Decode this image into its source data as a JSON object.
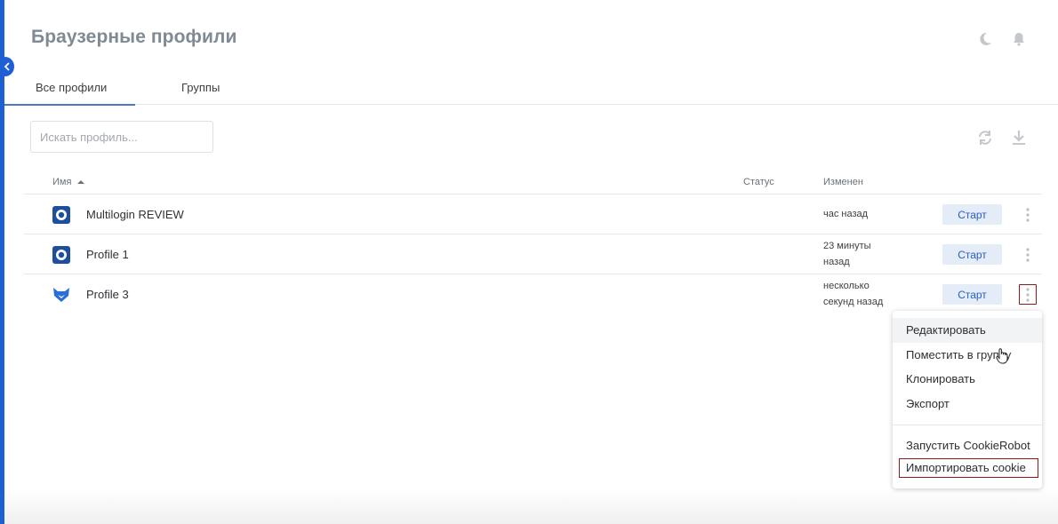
{
  "page_title": "Браузерные профили",
  "colors": {
    "accent": "#1f5fd6",
    "start_bg": "#e4ecf7",
    "highlight": "#8b1a1a"
  },
  "header_icons": [
    "moon-icon",
    "bell-icon"
  ],
  "tabs": [
    {
      "label": "Все профили",
      "active": true
    },
    {
      "label": "Группы",
      "active": false
    }
  ],
  "search": {
    "placeholder": "Искать профиль...",
    "value": ""
  },
  "toolbar_icons": [
    "refresh-icon",
    "download-icon"
  ],
  "table": {
    "headers": {
      "name": "Имя",
      "status": "Статус",
      "changed": "Изменен"
    },
    "rows": [
      {
        "name": "Multilogin REVIEW",
        "logo": "multilogin-logo-icon",
        "status": "",
        "changed_line1": "час назад",
        "changed_line2": "",
        "start_label": "Старт"
      },
      {
        "name": "Profile 1",
        "logo": "multilogin-logo-icon",
        "status": "",
        "changed_line1": "23 минуты",
        "changed_line2": "назад",
        "start_label": "Старт"
      },
      {
        "name": "Profile 3",
        "logo": "fox-logo-icon",
        "status": "",
        "changed_line1": "несколько",
        "changed_line2": "секунд назад",
        "start_label": "Старт"
      }
    ]
  },
  "context_menu": {
    "items": [
      "Редактировать",
      "Поместить в группу",
      "Клонировать",
      "Экспорт"
    ],
    "items_after_separator": [
      "Запустить CookieRobot",
      "Импортировать cookie"
    ]
  }
}
